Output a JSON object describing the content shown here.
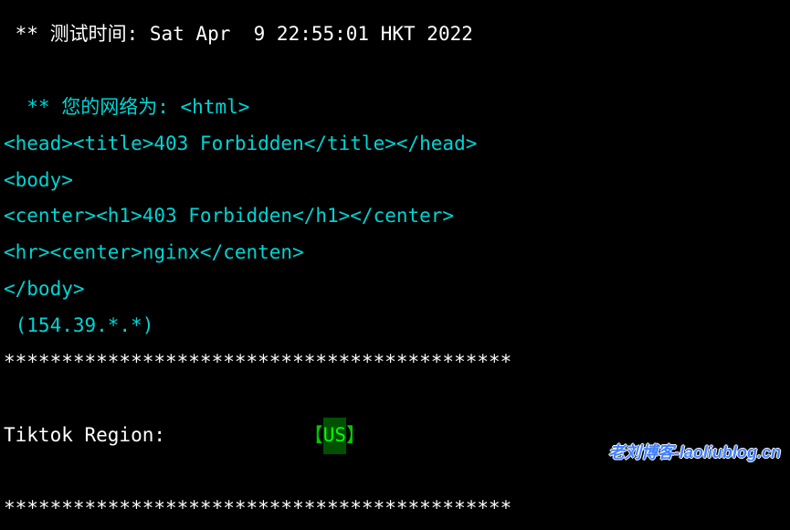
{
  "header": {
    "test_time_label": " ** 测试时间:",
    "test_time_value": " Sat Apr  9 22:55:01 HKT 2022"
  },
  "network": {
    "label": "  ** 您的网络为: ",
    "html_open": "<html>",
    "line2": "<head><title>403 Forbidden</title></head>",
    "line3": "<body>",
    "line4": "<center><h1>403 Forbidden</h1></center>",
    "line5": "<hr><center>nginx</centen>",
    "line6": "</body>",
    "ip": " (154.39.*.*)"
  },
  "divider": "********************************************",
  "region": {
    "label": " Tiktok Region:",
    "spacer": "            ",
    "left_bracket": "【",
    "value": "US",
    "right_bracket": "】"
  },
  "watermark": "老刘博客-laoliublog.cn"
}
